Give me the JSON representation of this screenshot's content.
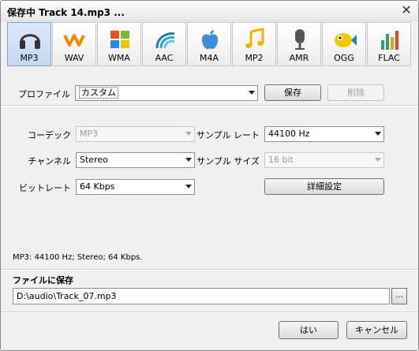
{
  "window": {
    "title": "保存中 Track 14.mp3 ...",
    "close_label": "✕"
  },
  "formats": [
    {
      "label": "MP3",
      "icon": "headphones-icon",
      "active": true
    },
    {
      "label": "WAV",
      "icon": "wav-wave-icon"
    },
    {
      "label": "WMA",
      "icon": "windows-flag-icon"
    },
    {
      "label": "AAC",
      "icon": "aac-wave-icon"
    },
    {
      "label": "M4A",
      "icon": "apple-icon"
    },
    {
      "label": "MP2",
      "icon": "music-note-icon"
    },
    {
      "label": "AMR",
      "icon": "microphone-icon"
    },
    {
      "label": "OGG",
      "icon": "fish-icon"
    },
    {
      "label": "FLAC",
      "icon": "equalizer-icon"
    }
  ],
  "profile": {
    "label": "プロファイル",
    "value": "カスタム",
    "save_label": "保存",
    "delete_label": "削除"
  },
  "settings": {
    "codec": {
      "label": "コーデック",
      "value": "MP3"
    },
    "channel": {
      "label": "チャンネル",
      "value": "Stereo"
    },
    "bitrate": {
      "label": "ビットレート",
      "value": "64 Kbps"
    },
    "sample_rate": {
      "label": "サンプル レート",
      "value": "44100 Hz"
    },
    "sample_size": {
      "label": "サンプル サイズ",
      "value": "16 bit"
    },
    "advanced_label": "詳細設定"
  },
  "status_text": "MP3: 44100  Hz; Stereo; 64 Kbps.",
  "save_to": {
    "label": "ファイルに保存",
    "path": "D:\\audio\\Track_07.mp3",
    "browse_label": "..."
  },
  "buttons": {
    "ok": "はい",
    "cancel": "キャンセル"
  }
}
